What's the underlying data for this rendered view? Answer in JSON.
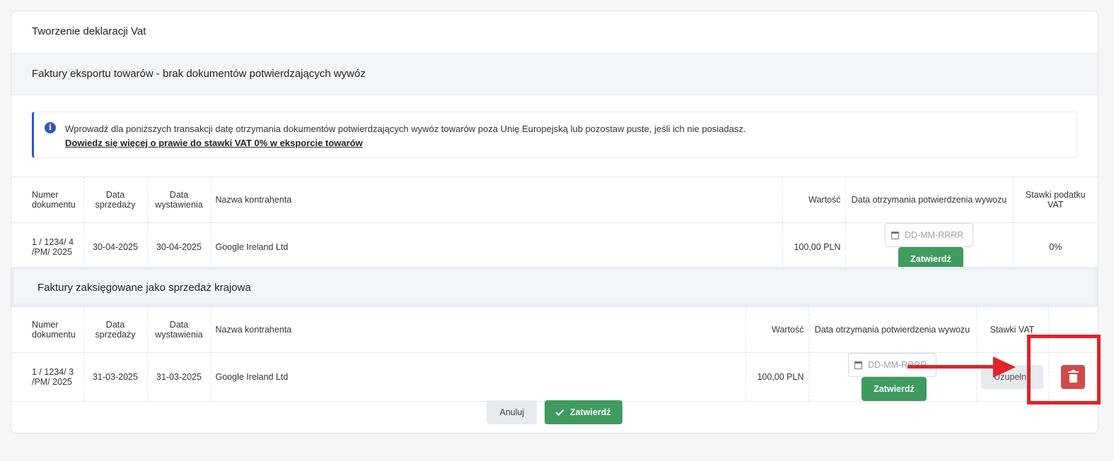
{
  "page": {
    "title": "Tworzenie deklaracji Vat"
  },
  "export_section": {
    "header": "Faktury eksportu towarów - brak dokumentów potwierdzających wywóz",
    "info_text": "Wprowadź dla poniższych transakcji datę otrzymania dokumentów potwierdzających wywóz towarów poza Unię Europejską lub pozostaw puste, jeśli ich nie posiadasz.",
    "info_link": "Dowiedz się więcej o prawie do stawki VAT 0% w eksporcie towarów",
    "columns": [
      "Numer dokumentu",
      "Data sprzedaży",
      "Data wystawienia",
      "Nazwa kontrahenta",
      "Wartość",
      "Data otrzymania potwierdzenia wywozu",
      "Stawki podatku VAT"
    ],
    "rows": [
      {
        "doc_number": "1 / 1234/ 4 /PM/ 2025",
        "sale_date": "30-04-2025",
        "issue_date": "30-04-2025",
        "contractor": "Google Ireland Ltd",
        "value": "100,00 PLN",
        "date_placeholder": "DD-MM-RRRR",
        "confirm_label": "Zatwierdź",
        "vat_rate": "0%"
      }
    ]
  },
  "domestic_section": {
    "header": "Faktury zaksięgowane jako sprzedaż krajowa",
    "columns": [
      "Numer dokumentu",
      "Data sprzedaży",
      "Data wystawienia",
      "Nazwa kontrahenta",
      "Wartość",
      "Data otrzymania potwierdzenia wywozu",
      "Stawki VAT"
    ],
    "rows": [
      {
        "doc_number": "1 / 1234/ 3 /PM/ 2025",
        "sale_date": "31-03-2025",
        "issue_date": "31-03-2025",
        "contractor": "Google Ireland Ltd",
        "value": "100,00 PLN",
        "date_placeholder": "DD-MM-RRRR",
        "confirm_label": "Zatwierdź",
        "vat_button_label": "Uzupełnij"
      }
    ]
  },
  "footer": {
    "cancel_label": "Anuluj",
    "confirm_label": "Zatwierdź"
  },
  "annotation_color": "#e0242a"
}
